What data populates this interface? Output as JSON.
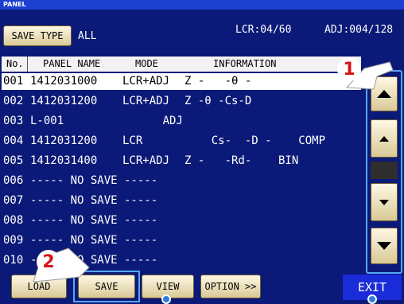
{
  "window": {
    "title": "PANEL"
  },
  "header": {
    "save_type_label": "SAVE TYPE",
    "save_type_value": "ALL",
    "lcr_count": "LCR:04/60",
    "adj_count": "ADJ:004/128"
  },
  "table": {
    "columns": [
      "No.",
      "PANEL NAME",
      "MODE",
      "INFORMATION"
    ],
    "rows": [
      {
        "no": "001",
        "name": "1412031000",
        "mode": "LCR+ADJ",
        "info": "Z -   -θ -",
        "selected": true
      },
      {
        "no": "002",
        "name": "1412031200",
        "mode": "LCR+ADJ",
        "info": "Z -θ -Cs-D",
        "selected": false
      },
      {
        "no": "003",
        "name": "L-001",
        "mode": "      ADJ",
        "info": "",
        "selected": false
      },
      {
        "no": "004",
        "name": "1412031200",
        "mode": "LCR",
        "info": "    Cs-  -D -    COMP",
        "selected": false
      },
      {
        "no": "005",
        "name": "1412031400",
        "mode": "LCR+ADJ",
        "info": "Z -   -Rd-    BIN",
        "selected": false
      },
      {
        "no": "006",
        "name": "----- NO SAVE -----",
        "mode": "",
        "info": "",
        "selected": false
      },
      {
        "no": "007",
        "name": "----- NO SAVE -----",
        "mode": "",
        "info": "",
        "selected": false
      },
      {
        "no": "008",
        "name": "----- NO SAVE -----",
        "mode": "",
        "info": "",
        "selected": false
      },
      {
        "no": "009",
        "name": "----- NO SAVE -----",
        "mode": "",
        "info": "",
        "selected": false
      },
      {
        "no": "010",
        "name": "----- NO SAVE -----",
        "mode": "",
        "info": "",
        "selected": false
      }
    ]
  },
  "scroll": {
    "page_up_icon": "triangle-up-large",
    "line_up_icon": "triangle-up",
    "line_down_icon": "triangle-down",
    "page_down_icon": "triangle-down-large"
  },
  "footer": {
    "load": "LOAD",
    "save": "SAVE",
    "view": "VIEW",
    "option": "OPTION >>",
    "exit": "EXIT"
  },
  "callouts": {
    "one": "1",
    "two": "2"
  },
  "colors": {
    "background": "#0b1a78",
    "highlight": "#58a6f5",
    "callout_number": "#d4161b",
    "exit_bg": "#1a2cd8"
  }
}
